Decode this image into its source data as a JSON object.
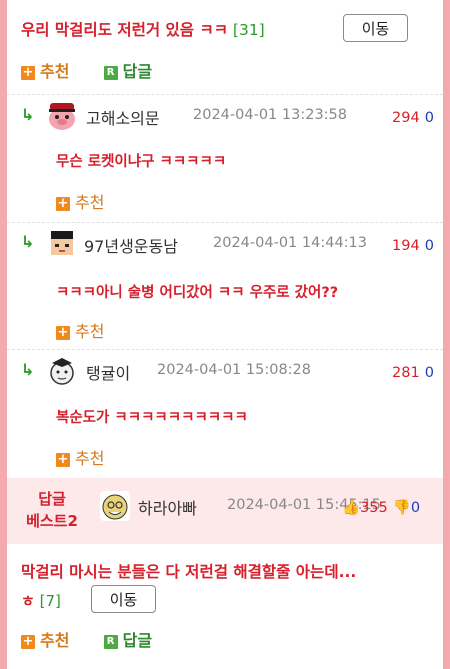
{
  "top_post": {
    "title": "우리 막걸리도 저런거 있음 ㅋㅋ",
    "count": "[31]",
    "move_label": "이동",
    "recommend_label": "추천",
    "reply_label": "답글"
  },
  "comments": [
    {
      "nick": "고해소의문",
      "date": "2024-04-01 13:23:58",
      "up": "294",
      "down": "0",
      "text": "무슨 로켓이냐구 ㅋㅋㅋㅋㅋ",
      "recommend_label": "추천"
    },
    {
      "nick": "97년생운동남",
      "date": "2024-04-01 14:44:13",
      "up": "194",
      "down": "0",
      "text": "ㅋㅋㅋ아니 술병 어디갔어 ㅋㅋ 우주로 갔어??",
      "recommend_label": "추천"
    },
    {
      "nick": "탱귤이",
      "date": "2024-04-01 15:08:28",
      "up": "281",
      "down": "0",
      "text": "복순도가 ㅋㅋㅋㅋㅋㅋㅋㅋㅋㅋ",
      "recommend_label": "추천"
    }
  ],
  "best": {
    "label_line1": "답글",
    "label_line2": "베스트2",
    "nick": "하라아빠",
    "date": "2024-04-01 15:45:15",
    "up": "355",
    "down": "0"
  },
  "bottom_post": {
    "title": "막걸리 마시는 분들은 다 저런걸 해결할줄 아는데...",
    "title_tail": "ㅎ",
    "count": "[7]",
    "move_label": "이동",
    "recommend_label": "추천",
    "reply_label": "답글"
  },
  "colors": {
    "background_border": "#f3a9ad",
    "title_red": "#d6202c",
    "count_green": "#2e9a2e",
    "recommend_orange": "#d67a1a",
    "downvote_blue": "#1a3cc0",
    "best_bg": "#fde8ea"
  },
  "icons": {
    "plus": "plus-icon",
    "reply_badge": "reply-r-icon",
    "reply_arrow": "reply-arrow-icon",
    "thumb_up": "thumbs-up-icon",
    "thumb_down": "thumbs-down-icon"
  }
}
